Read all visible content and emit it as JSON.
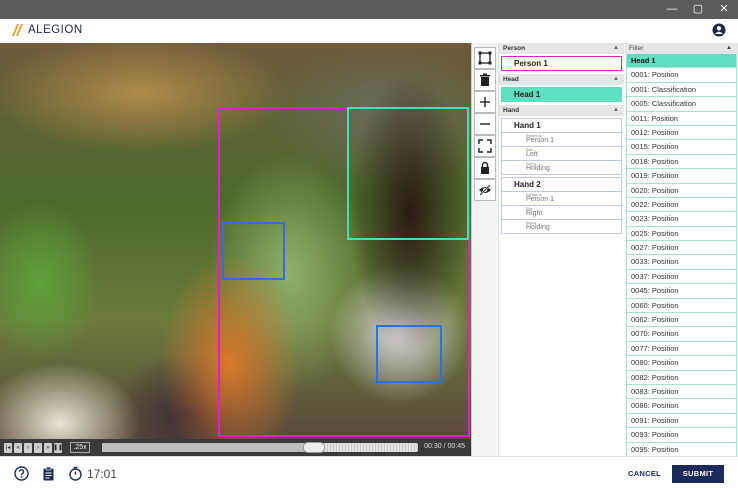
{
  "app": {
    "brand": "ALEGION"
  },
  "window": {
    "minimize": "—",
    "maximize": "▢",
    "close": "✕"
  },
  "player": {
    "speed": ".25x",
    "time": "00:30 / 00:45",
    "progress": 0.67,
    "controls": [
      "step-back",
      "rewind",
      "prev-frame",
      "next-frame",
      "fast-forward",
      "pause"
    ]
  },
  "toolbar": {
    "tools": [
      "bounding-box-icon",
      "delete-icon",
      "zoom-in-icon",
      "zoom-out-icon",
      "fit-screen-icon",
      "lock-icon",
      "hide-icon"
    ]
  },
  "panel": {
    "person": {
      "title": "Person",
      "items": [
        {
          "label": "Person 1"
        }
      ]
    },
    "head": {
      "title": "Head",
      "items": [
        {
          "label": "Head 1"
        }
      ]
    },
    "hand": {
      "title": "Hand",
      "items": [
        {
          "label": "Hand 1",
          "attrs": [
            {
              "key": "Relates to",
              "value": "Person 1"
            },
            {
              "key": "Side",
              "value": "Left"
            },
            {
              "key": "Action",
              "value": "Holding"
            }
          ]
        },
        {
          "label": "Hand 2",
          "attrs": [
            {
              "key": "Relates to",
              "value": "Person 1"
            },
            {
              "key": "Side",
              "value": "Right"
            },
            {
              "key": "Action",
              "value": "Holding"
            }
          ]
        }
      ]
    }
  },
  "filter": {
    "title": "Filter",
    "selected": "Head 1",
    "rows": [
      "0001: Position",
      "0001: Classification",
      "0005: Classification",
      "0011: Position",
      "0012: Position",
      "0015: Position",
      "0018: Position",
      "0019: Position",
      "0020: Position",
      "0022: Position",
      "0023: Position",
      "0025: Position",
      "0027: Position",
      "0033: Position",
      "0037: Position",
      "0045: Position",
      "0060: Position",
      "0062: Position",
      "0070: Position",
      "0077: Position",
      "0080: Position",
      "0082: Position",
      "0083: Position",
      "0086: Position",
      "0091: Position",
      "0093: Position",
      "0095: Position"
    ]
  },
  "footer": {
    "timer": "17:01",
    "cancel_label": "CANCEL",
    "submit_label": "SUBMIT"
  },
  "colors": {
    "accent": "#5ee0c0",
    "person_box": "#e020c8",
    "head_box": "#3ee0c0",
    "hand_box": "#2f6fe0",
    "primary": "#1b2a5a"
  }
}
